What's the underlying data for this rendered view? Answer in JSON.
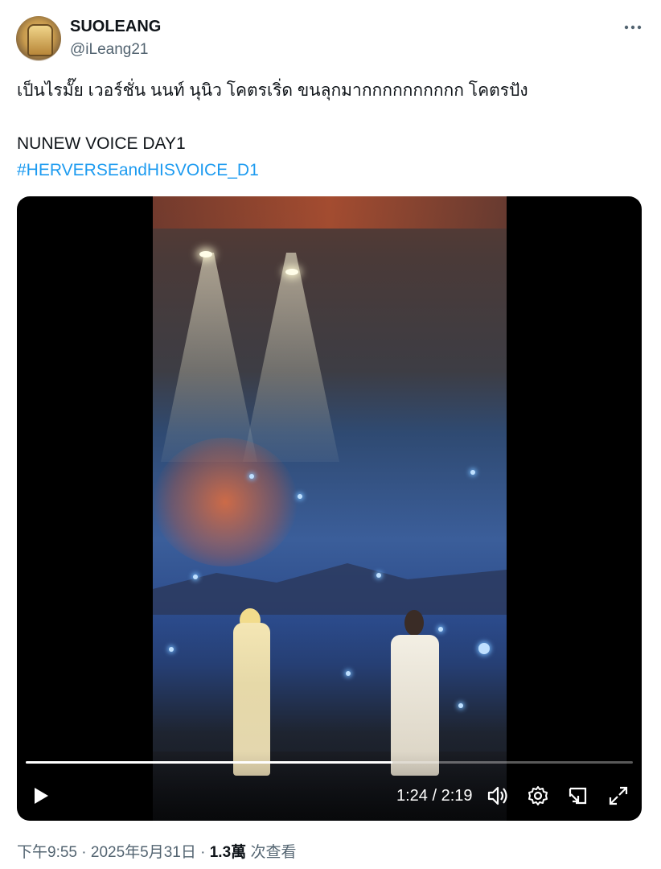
{
  "author": {
    "display_name": "SUOLEANG",
    "handle": "@iLeang21"
  },
  "more_icon": "more-horizontal-icon",
  "tweet": {
    "line1": "เป็นไรมั๊ย เวอร์ชั่น นนท์ นุนิว โคตรเริ่ด ขนลุกมากกกกกกกกกก โคตรปัง",
    "line2": "NUNEW VOICE DAY1",
    "hashtag": "#HERVERSEandHISVOICE_D1"
  },
  "video": {
    "current_time": "1:24",
    "separator": "/",
    "duration": "2:19",
    "progress_fraction": 0.604,
    "icons": [
      "play-icon",
      "volume-icon",
      "settings-icon",
      "pip-icon",
      "fullscreen-icon"
    ]
  },
  "meta": {
    "time": "下午9:55",
    "dot1": "·",
    "date": "2025年5月31日",
    "dot2": "·",
    "views": "1.3萬",
    "views_label": "次查看"
  },
  "colors": {
    "text": "#0f1419",
    "secondary": "#536471",
    "link": "#1d9bf0"
  }
}
